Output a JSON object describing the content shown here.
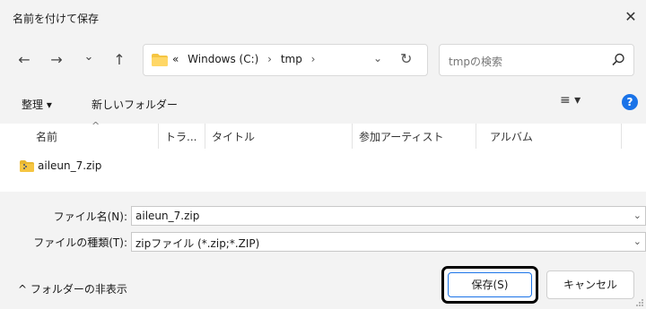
{
  "window": {
    "title": "名前を付けて保存",
    "close_symbol": "✕"
  },
  "nav": {
    "back_symbol": "←",
    "forward_symbol": "→",
    "recent_symbol": "⌄",
    "up_symbol": "↑",
    "path_prefix": "«",
    "path_items": [
      "Windows (C:)",
      "tmp"
    ],
    "path_sep": "›",
    "path_chevron": "⌄",
    "refresh_symbol": "↻",
    "search_placeholder": "tmpの検索"
  },
  "toolbar": {
    "organize_label": "整理 ▾",
    "new_folder_label": "新しいフォルダー",
    "view_symbol": "≡ ▾",
    "help_symbol": "?"
  },
  "columns": {
    "sort_caret": "^",
    "headers": [
      "名前",
      "トラ...",
      "タイトル",
      "参加アーティスト",
      "アルバム"
    ]
  },
  "files": [
    {
      "name": "aileun_7.zip",
      "icon": "zip-folder-icon"
    }
  ],
  "form": {
    "filename_label": "ファイル名(N):",
    "filename_value": "aileun_7.zip",
    "filetype_label": "ファイルの種類(T):",
    "filetype_value": "zipファイル (*.zip;*.ZIP)",
    "dropdown_symbol": "⌄"
  },
  "footer": {
    "toggle_folders_label": "^ フォルダーの非表示",
    "save_label": "保存(S)",
    "cancel_label": "キャンセル"
  },
  "colors": {
    "chrome_bg": "#f3f3f3",
    "accent": "#1a73e8",
    "folder_yellow": "#f5c542"
  }
}
